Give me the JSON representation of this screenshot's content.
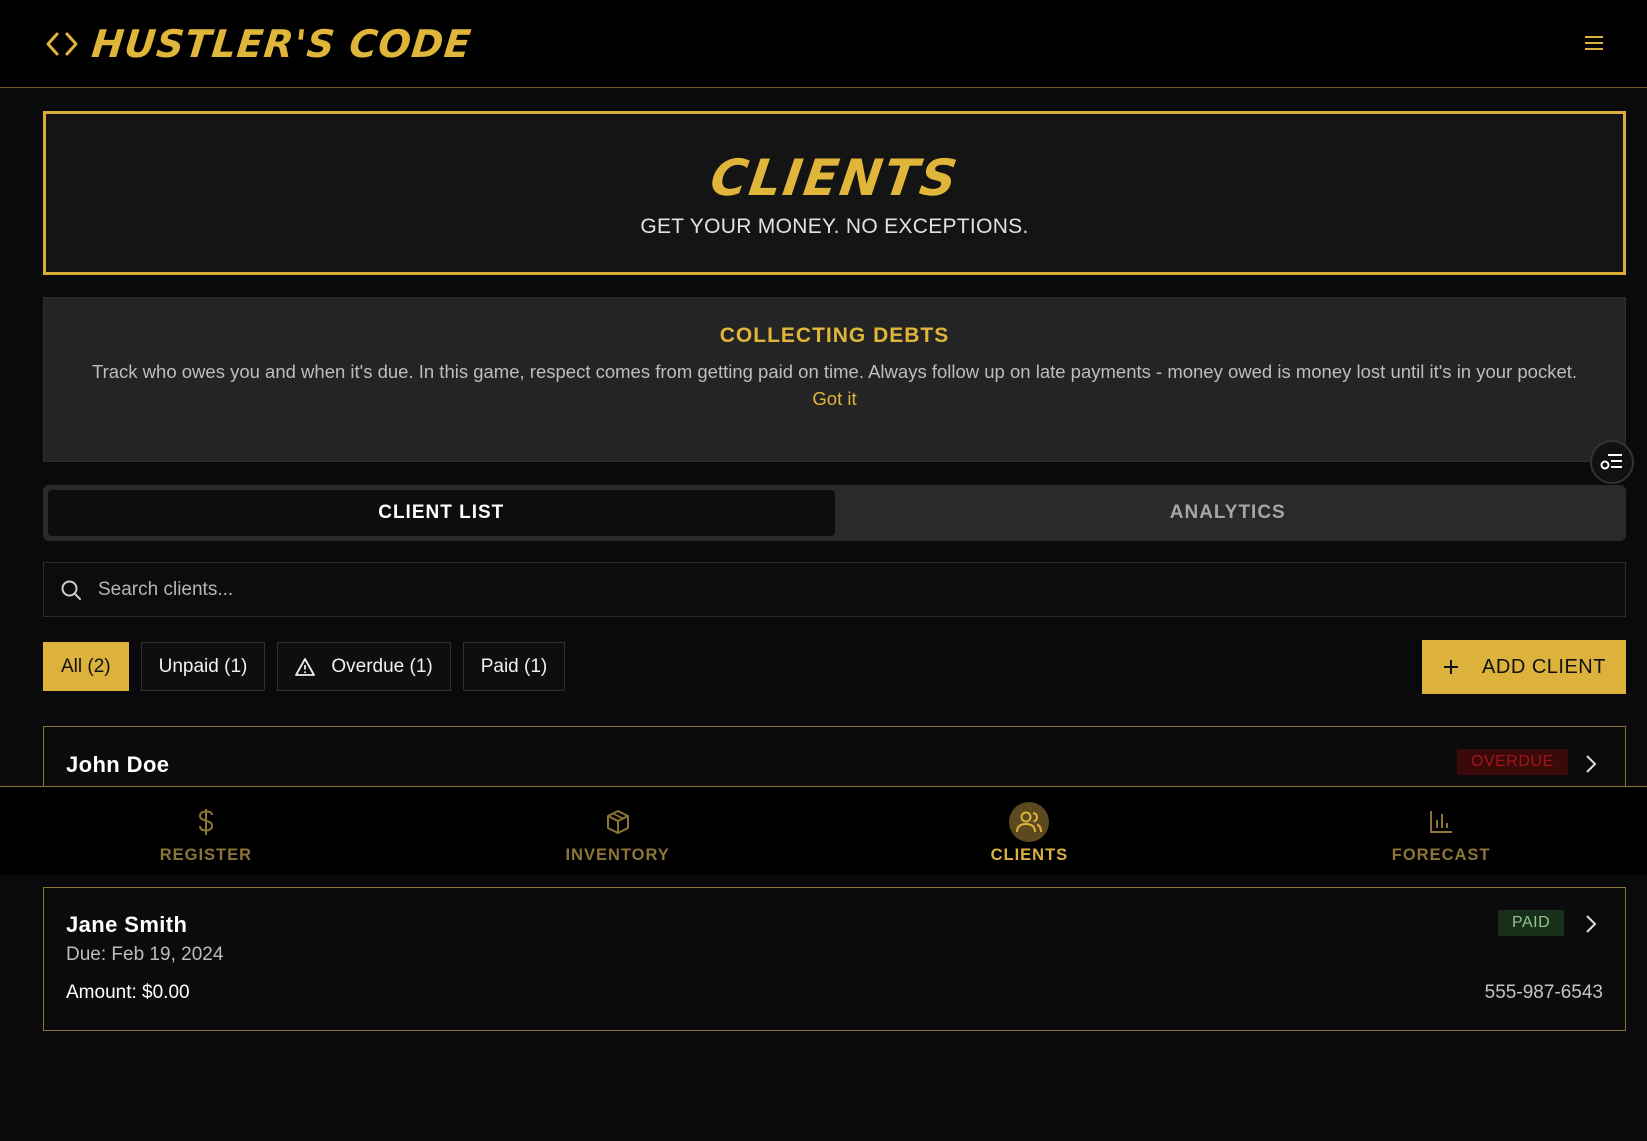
{
  "app": {
    "title": "HUSTLER'S CODE",
    "accent": "#dcb23c",
    "icons": {
      "brand": "code-brackets-icon",
      "menu": "hamburger-menu-icon"
    }
  },
  "hero": {
    "title": "CLIENTS",
    "subtitle": "GET YOUR MONEY. NO EXCEPTIONS."
  },
  "tip": {
    "title": "COLLECTING DEBTS",
    "body": "Track who owes you and when it's due. In this game, respect comes from getting paid on time. Always follow up on late payments - money owed is money lost until it's in your pocket.",
    "dismiss_label": "Got it"
  },
  "tabs": [
    {
      "label": "CLIENT LIST",
      "active": true
    },
    {
      "label": "ANALYTICS",
      "active": false
    }
  ],
  "search": {
    "placeholder": "Search clients...",
    "value": ""
  },
  "filters": [
    {
      "label": "All (2)",
      "active": true
    },
    {
      "label": "Unpaid (1)",
      "active": false
    },
    {
      "label": "Overdue (1)",
      "active": false,
      "icon": "warning-triangle-icon"
    },
    {
      "label": "Paid (1)",
      "active": false
    }
  ],
  "add_client": {
    "label": "ADD CLIENT",
    "icon": "plus-icon"
  },
  "clients": [
    {
      "name": "John Doe",
      "status": "OVERDUE",
      "status_color": "#a11818"
    },
    {
      "name": "Jane Smith",
      "status": "PAID",
      "status_color": "#8ec58a",
      "due": "Due: Feb 19, 2024",
      "amount": "Amount: $0.00",
      "phone": "555-987-6543"
    }
  ],
  "bottom_nav": [
    {
      "label": "REGISTER",
      "icon": "dollar-icon",
      "active": false
    },
    {
      "label": "INVENTORY",
      "icon": "box-icon",
      "active": false
    },
    {
      "label": "CLIENTS",
      "icon": "users-icon",
      "active": true
    },
    {
      "label": "FORECAST",
      "icon": "bar-chart-icon",
      "active": false
    }
  ]
}
